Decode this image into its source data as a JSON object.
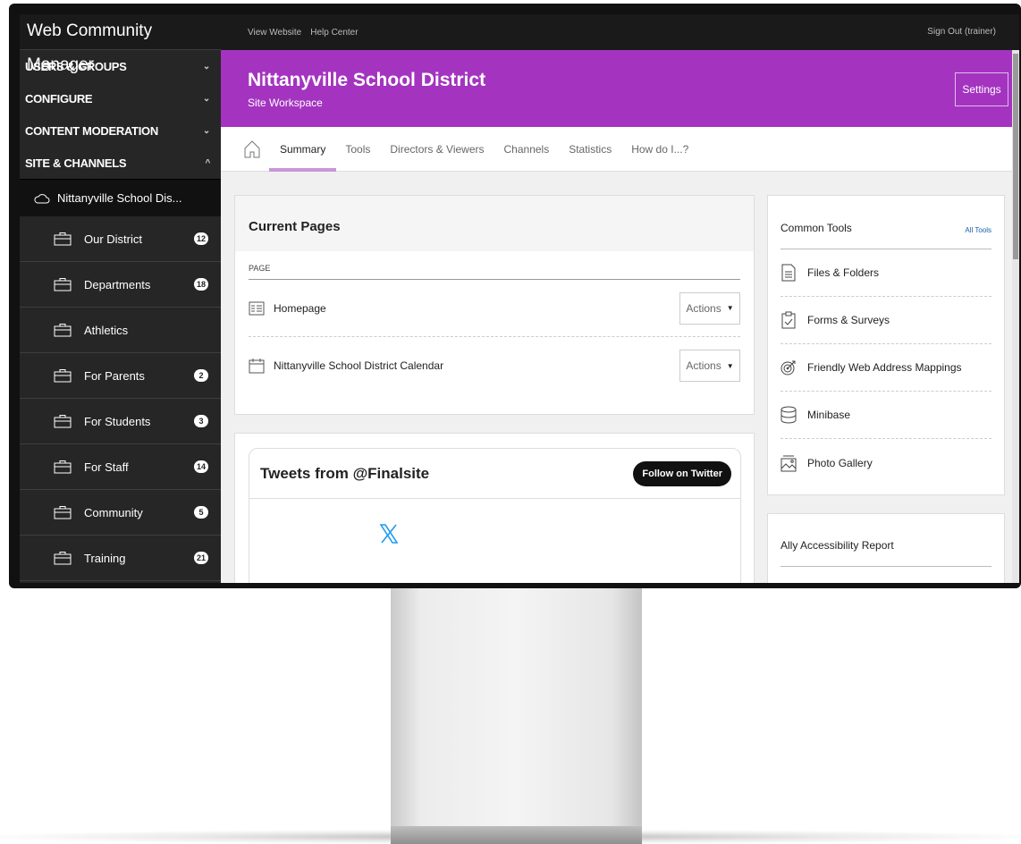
{
  "app": {
    "title": "Web Community Manager"
  },
  "sidebar": {
    "sections": [
      {
        "label": "USERS & GROUPS",
        "chevron": "⌄"
      },
      {
        "label": "CONFIGURE",
        "chevron": "⌄"
      },
      {
        "label": "CONTENT MODERATION",
        "chevron": "⌄"
      },
      {
        "label": "SITE & CHANNELS",
        "chevron": "^"
      }
    ],
    "site": "Nittanyville School Dis...",
    "channels": [
      {
        "label": "Our District",
        "count": "12"
      },
      {
        "label": "Departments",
        "count": "18"
      },
      {
        "label": "Athletics",
        "count": ""
      },
      {
        "label": "For Parents",
        "count": "2"
      },
      {
        "label": "For Students",
        "count": "3"
      },
      {
        "label": "For Staff",
        "count": "14"
      },
      {
        "label": "Community",
        "count": "5"
      },
      {
        "label": "Training",
        "count": "21"
      }
    ]
  },
  "topbar": {
    "view_website": "View Website",
    "help_center": "Help Center",
    "sign_out": "Sign Out (trainer)"
  },
  "banner": {
    "title": "Nittanyville School District",
    "subtitle": "Site Workspace",
    "settings": "Settings",
    "color": "#a434c0"
  },
  "tabs": [
    {
      "label": "Summary"
    },
    {
      "label": "Tools"
    },
    {
      "label": "Directors & Viewers"
    },
    {
      "label": "Channels"
    },
    {
      "label": "Statistics"
    },
    {
      "label": "How do I...?"
    }
  ],
  "current_pages": {
    "title": "Current Pages",
    "column": "PAGE",
    "rows": [
      {
        "label": "Homepage",
        "actions": "Actions"
      },
      {
        "label": "Nittanyville School District Calendar",
        "actions": "Actions"
      }
    ]
  },
  "tweets": {
    "title": "Tweets from @Finalsite",
    "follow": "Follow on Twitter"
  },
  "common_tools": {
    "title": "Common Tools",
    "all_tools": "All Tools",
    "items": [
      {
        "label": "Files & Folders",
        "icon": "file-icon"
      },
      {
        "label": "Forms & Surveys",
        "icon": "clipboard-check-icon"
      },
      {
        "label": "Friendly Web Address Mappings",
        "icon": "target-icon"
      },
      {
        "label": "Minibase",
        "icon": "database-icon"
      },
      {
        "label": "Photo Gallery",
        "icon": "photo-icon"
      }
    ]
  },
  "ally": {
    "title": "Ally Accessibility Report"
  }
}
